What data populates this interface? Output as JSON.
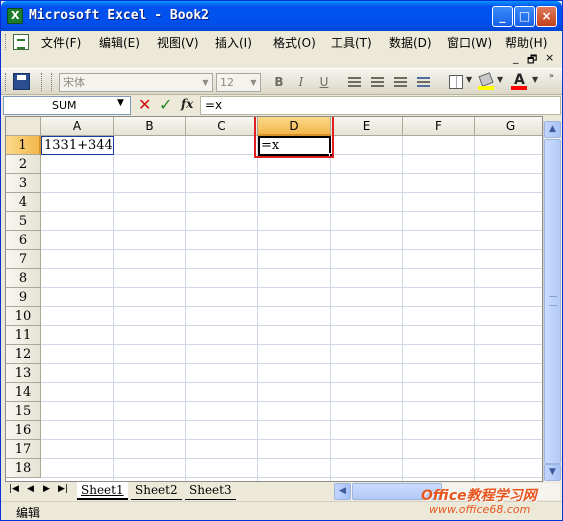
{
  "window": {
    "title": "Microsoft Excel - Book2",
    "minimize_glyph": "_",
    "maximize_glyph": "□",
    "close_glyph": "×"
  },
  "menubar": {
    "items": [
      {
        "label": "文件(F)"
      },
      {
        "label": "编辑(E)"
      },
      {
        "label": "视图(V)"
      },
      {
        "label": "插入(I)"
      },
      {
        "label": "格式(O)"
      },
      {
        "label": "工具(T)"
      },
      {
        "label": "数据(D)"
      },
      {
        "label": "窗口(W)"
      },
      {
        "label": "帮助(H)"
      }
    ],
    "mdi_minimize": "_",
    "mdi_restore": "🗗",
    "mdi_close": "×"
  },
  "toolbar": {
    "font_name": "宋体",
    "font_size": "12",
    "bold": "B",
    "italic": "I",
    "underline": "U"
  },
  "formula_bar": {
    "name_box": "SUM",
    "cancel_glyph": "✕",
    "enter_glyph": "✓",
    "insert_function": "fx",
    "content": "=x"
  },
  "sheet": {
    "columns": [
      "A",
      "B",
      "C",
      "D",
      "E",
      "F",
      "G"
    ],
    "rows": [
      "1",
      "2",
      "3",
      "4",
      "5",
      "6",
      "7",
      "8",
      "9",
      "10",
      "11",
      "12",
      "13",
      "14",
      "15",
      "16",
      "17",
      "18"
    ],
    "active_column": "D",
    "active_row": "1",
    "cells": {
      "A1": "1331+344",
      "D1": "=x"
    },
    "highlight_color": "#e02020"
  },
  "tabs": {
    "nav_first": "|◀",
    "nav_prev": "◀",
    "nav_next": "▶",
    "nav_last": "▶|",
    "sheets": [
      {
        "label": "Sheet1"
      },
      {
        "label": "Sheet2"
      },
      {
        "label": "Sheet3"
      }
    ]
  },
  "status": {
    "mode": "编辑"
  },
  "watermark": {
    "line1": "Office教程学习网",
    "line2": "www.office68.com"
  }
}
